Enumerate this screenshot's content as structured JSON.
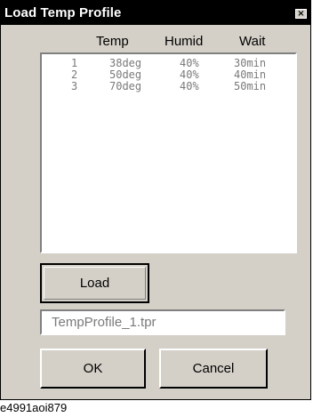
{
  "window": {
    "title": "Load Temp Profile",
    "close_glyph": "×"
  },
  "columns": [
    "Temp",
    "Humid",
    "Wait"
  ],
  "rows": [
    {
      "index": "1",
      "temp": "38deg",
      "humid": "40%",
      "wait": "30min"
    },
    {
      "index": "2",
      "temp": "50deg",
      "humid": "40%",
      "wait": "40min"
    },
    {
      "index": "3",
      "temp": "70deg",
      "humid": "40%",
      "wait": "50min"
    }
  ],
  "buttons": {
    "load": "Load",
    "ok": "OK",
    "cancel": "Cancel"
  },
  "file_field": {
    "value": "TempProfile_1.tpr"
  },
  "caption": "e4991aoi879"
}
